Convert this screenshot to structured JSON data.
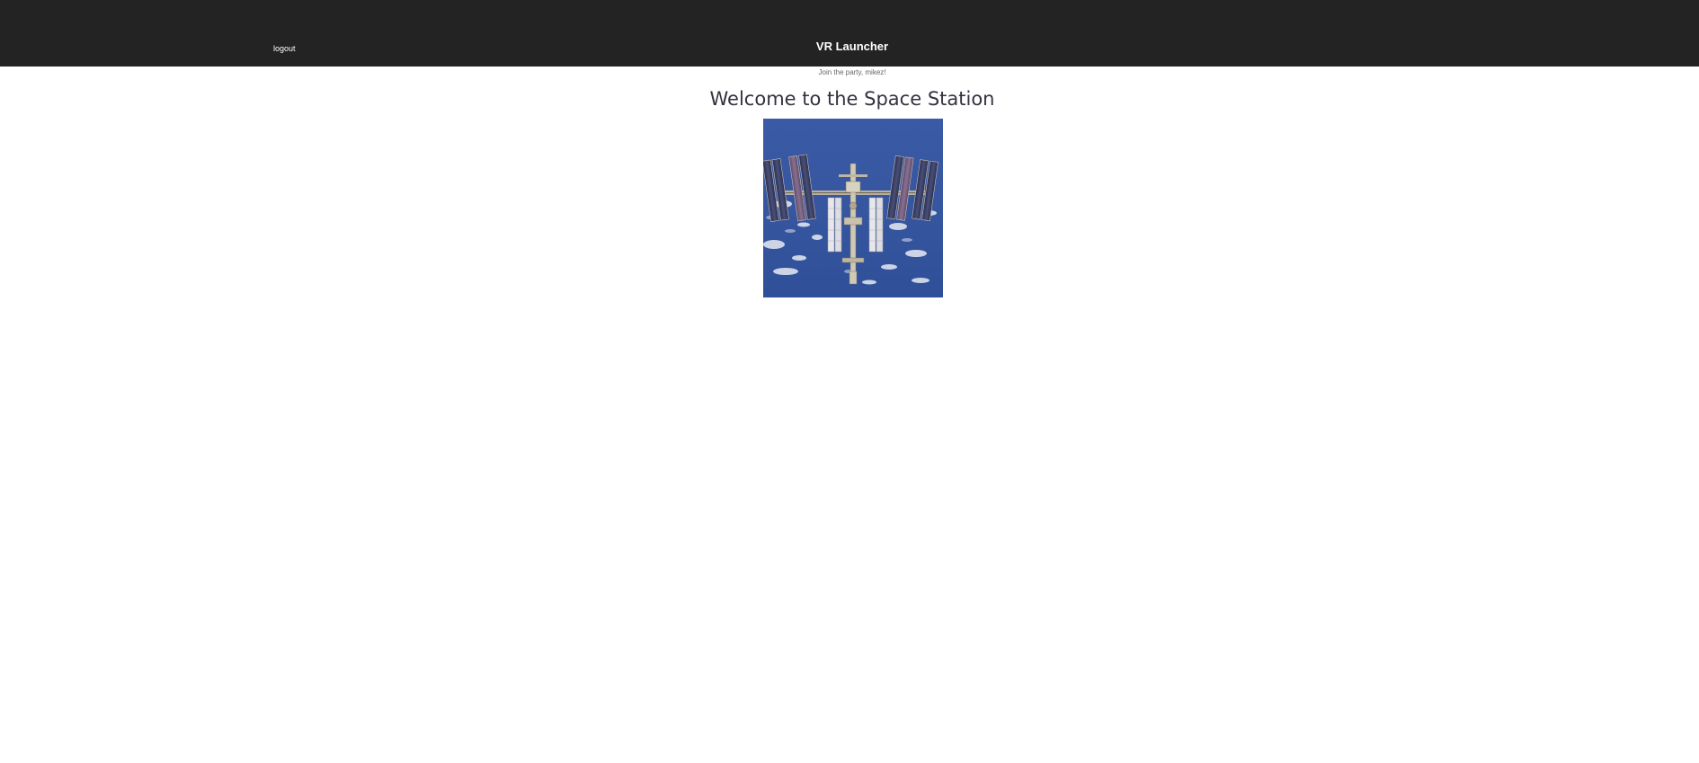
{
  "header": {
    "logout_label": "logout",
    "title": "VR Launcher",
    "background_color": "#232323"
  },
  "main": {
    "greeting": "Join the party, mikez!",
    "heading": "Welcome to the Space Station",
    "image": {
      "subject": "International Space Station over Earth"
    }
  }
}
